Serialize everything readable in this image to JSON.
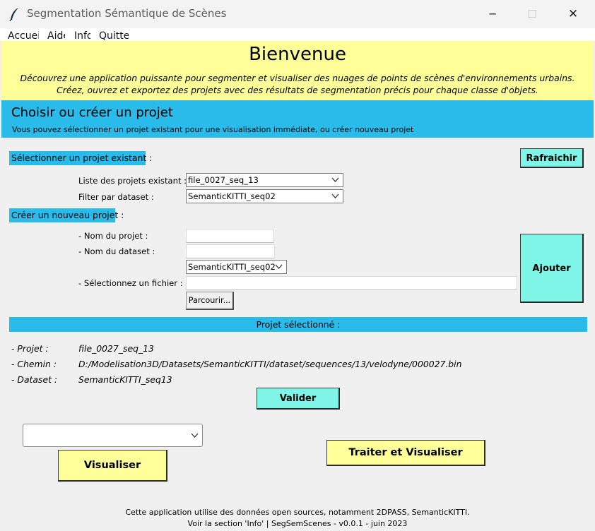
{
  "window": {
    "title": "Segmentation Sémantique de Scènes",
    "minimize_glyph": "─",
    "maximize_glyph": "☐",
    "close_glyph": "✕",
    "icon": "feather-icon"
  },
  "menu": [
    "Accueil",
    "Aide",
    "Info",
    "Quitter"
  ],
  "welcome": {
    "title": "Bienvenue",
    "line1": "Découvrez une application puissante pour segmenter et visualiser des nuages de points de scènes d'environnements urbains.",
    "line2": "Créez, ouvrez et exportez des projets avec des résultats de segmentation précis pour chaque classe d'objets."
  },
  "project_header": {
    "title": "Choisir ou créer un projet",
    "subtitle": "Vous pouvez sélectionner un projet existant pour une visualisation immédiate, ou créer nouveau projet"
  },
  "existing": {
    "section_label": "Sélectionner un projet existant :",
    "refresh_label": "Rafraichir",
    "list_label": "Liste des projets existant :",
    "list_value": "file_0027_seq_13",
    "filter_label": "Filter par dataset :",
    "filter_value": "SemanticKITTI_seq02"
  },
  "create": {
    "section_label": "Créer un nouveau projet :",
    "name_label": "- Nom du projet :",
    "name_value": "",
    "dataset_label": "- Nom du dataset :",
    "dataset_value": "",
    "dataset_combo_value": "SemanticKITTI_seq02",
    "file_label": "- Sélectionnez un fichier :",
    "file_value": "",
    "browse_label": "Parcourir...",
    "add_label": "Ajouter"
  },
  "selected": {
    "bar_label": "Projet sélectionné :",
    "project_label": "- Projet :",
    "project_value": "file_0027_seq_13",
    "path_label": "- Chemin :",
    "path_value": "D:/Modelisation3D/Datasets/SemanticKITTI/dataset/sequences/13/velodyne/000027.bin",
    "dataset_label": "- Dataset :",
    "dataset_value": "SemanticKITTI_seq13",
    "validate_label": "Valider"
  },
  "actions": {
    "visualize_combo_value": "",
    "visualize_label": "Visualiser",
    "process_label": "Traiter et Visualiser"
  },
  "footer": {
    "line1": "Cette application utilise des données open sources, notamment 2DPASS, SemanticKITTI.",
    "line2": "Voir la section 'Info' | SegSemScenes - v0.0.1 - juin 2023"
  },
  "colors": {
    "banner_yellow": "#ffff99",
    "header_blue": "#29bceb",
    "button_cyan": "#7ff5e8",
    "button_yellow": "#ffff99",
    "background": "#f0f0f0"
  }
}
